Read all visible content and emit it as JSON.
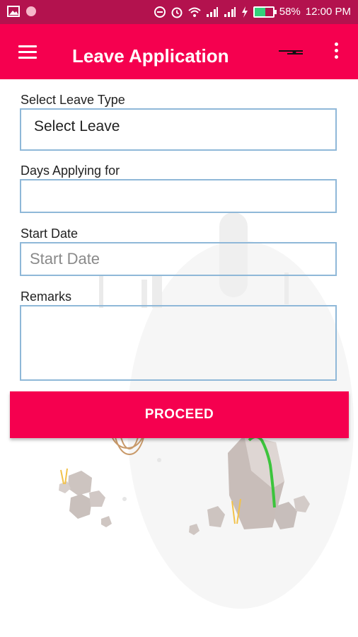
{
  "status_bar": {
    "battery": "58%",
    "time": "12:00 PM",
    "icons": [
      "image-icon",
      "circle-icon",
      "dnd-icon",
      "alarm-icon",
      "wifi-icon",
      "signal-icon",
      "signal-icon",
      "charging-icon",
      "battery-icon"
    ]
  },
  "app_bar": {
    "title": "Leave Application",
    "menu_icon": "hamburger-menu-icon",
    "action_icon": "toggle-icon",
    "more_icon": "more-vertical-icon"
  },
  "form": {
    "leave_type_label": "Select Leave Type",
    "leave_type_value": "Select Leave",
    "days_label": "Days Applying for",
    "days_value": "",
    "start_date_label": "Start Date",
    "start_date_placeholder": "Start Date",
    "remarks_label": "Remarks",
    "remarks_value": ""
  },
  "proceed_label": "PROCEED",
  "colors": {
    "status_bar": "#b3124e",
    "app_bar": "#f5004f",
    "field_border": "#8fb8d8",
    "button": "#f5004f"
  }
}
